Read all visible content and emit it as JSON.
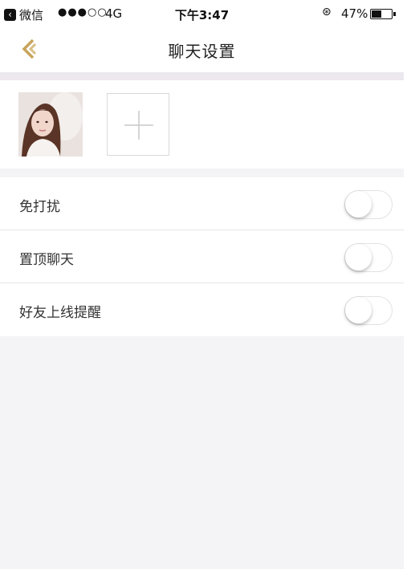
{
  "status_bar": {
    "back_app_label": "微信",
    "signal": "●●●○○",
    "network": "4G",
    "time": "下午3:47",
    "battery_percent": "47%",
    "battery_level": 0.47
  },
  "nav": {
    "title": "聊天设置",
    "back_icon": "chevron-left-icon",
    "accent_color": "#c8a45a"
  },
  "members": {
    "add_icon": "plus-icon"
  },
  "settings": {
    "items": [
      {
        "label": "免打扰",
        "enabled": false
      },
      {
        "label": "置顶聊天",
        "enabled": false
      },
      {
        "label": "好友上线提醒",
        "enabled": false
      }
    ]
  }
}
